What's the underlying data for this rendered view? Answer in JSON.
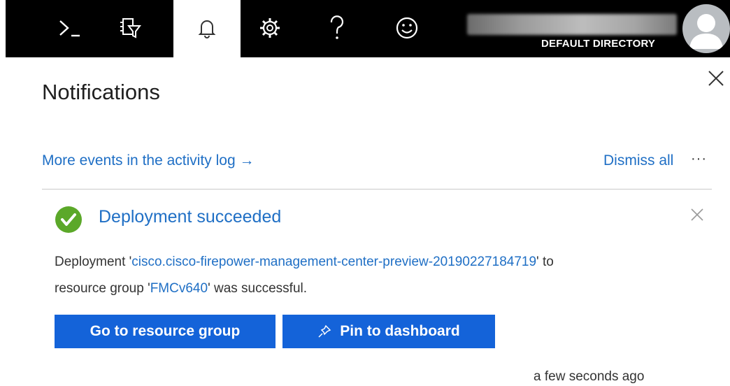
{
  "topbar": {
    "icons": [
      "cloud-shell-icon",
      "directory-filter-icon",
      "notifications-bell-icon",
      "settings-gear-icon",
      "help-icon",
      "feedback-smiley-icon"
    ],
    "directory_label": "DEFAULT DIRECTORY"
  },
  "panel": {
    "title": "Notifications",
    "activity_link": "More events in the activity log →",
    "dismiss_all": "Dismiss all",
    "more": "···"
  },
  "notification": {
    "status": "success",
    "title": "Deployment succeeded",
    "body_prefix": "Deployment '",
    "deployment_name": "cisco.cisco-firepower-management-center-preview-20190227184719",
    "body_middle": "' to resource group '",
    "resource_group": "FMCv640",
    "body_suffix": "' was successful.",
    "primary_button": "Go to resource group",
    "secondary_button": "Pin to dashboard",
    "timestamp": "a few seconds ago"
  },
  "colors": {
    "accent": "#1f6fc5",
    "button": "#1463d9",
    "success": "#5ba829",
    "topbar": "#000000"
  }
}
